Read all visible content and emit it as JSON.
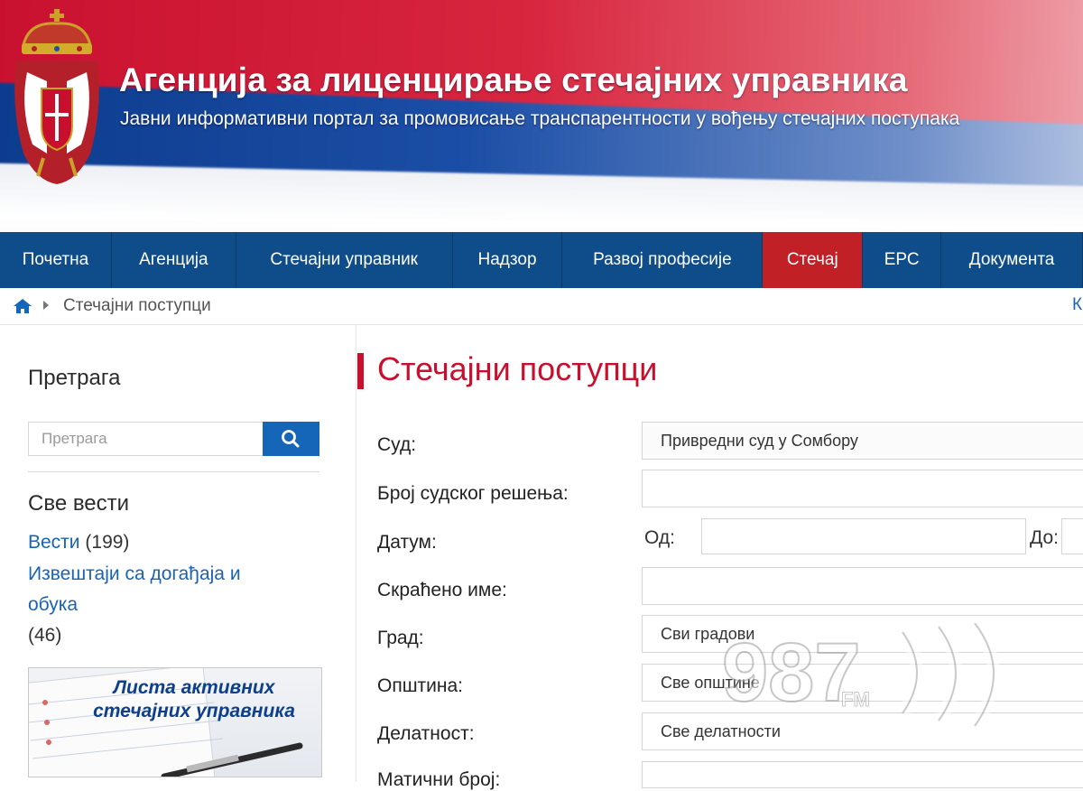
{
  "header": {
    "title": "Агенција за лиценцирање стечајних управника",
    "subtitle": "Јавни информативни портал за промовисање транспарентности у вођењу стечајних поступака"
  },
  "nav": {
    "items": [
      {
        "label": "Почетна"
      },
      {
        "label": "Агенција"
      },
      {
        "label": "Стечајни управник"
      },
      {
        "label": "Надзор"
      },
      {
        "label": "Развој професије"
      },
      {
        "label": "Стечај",
        "active": true
      },
      {
        "label": "ЕРС"
      },
      {
        "label": "Документа"
      }
    ]
  },
  "breadcrumb": {
    "current": "Стечајни поступци",
    "right_fragment": "К"
  },
  "sidebar": {
    "search_heading": "Претрага",
    "search_placeholder": "Претрага",
    "news_heading": "Све вести",
    "links": [
      {
        "label": "Вести",
        "count": "(199)"
      },
      {
        "label_line1": "Извештаји са догађаја и",
        "label_line2": "обука",
        "count": "(46)"
      }
    ],
    "banner": {
      "line1": "Листа активних",
      "line2": "стечајних управника"
    }
  },
  "main": {
    "title": "Стечајни поступци",
    "form": {
      "court_label": "Суд:",
      "court_value": "Привредни суд у Сомбору",
      "decision_label": "Број судског решења:",
      "decision_value": "",
      "date_label": "Датум:",
      "date_from_label": "Од:",
      "date_to_label": "До:",
      "short_name_label": "Скраћено име:",
      "short_name_value": "",
      "city_label": "Град:",
      "city_value": "Сви градови",
      "municipality_label": "Општина:",
      "municipality_value": "Све општине",
      "activity_label": "Делатност:",
      "activity_value": "Све делатности",
      "reg_number_label": "Матични број:"
    }
  },
  "watermark": {
    "number": "987",
    "unit": "FM"
  },
  "colors": {
    "nav_bg": "#0e4c8a",
    "active": "#c02026",
    "accent_red": "#c8102e",
    "link": "#1a64b4",
    "search_btn": "#1565b8"
  }
}
